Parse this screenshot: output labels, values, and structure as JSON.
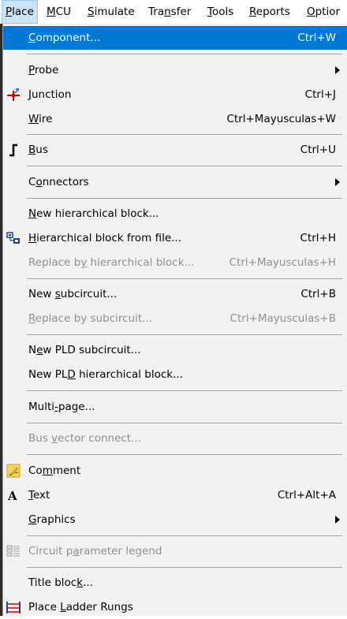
{
  "menubar": {
    "items": [
      {
        "pre": "",
        "acc": "P",
        "post": "lace"
      },
      {
        "pre": "",
        "acc": "M",
        "post": "CU"
      },
      {
        "pre": "",
        "acc": "S",
        "post": "imulate"
      },
      {
        "pre": "Tra",
        "acc": "n",
        "post": "sfer"
      },
      {
        "pre": "",
        "acc": "T",
        "post": "ools"
      },
      {
        "pre": "",
        "acc": "R",
        "post": "eports"
      },
      {
        "pre": "",
        "acc": "O",
        "post": "ptior"
      }
    ]
  },
  "menu": {
    "component": {
      "pre": "",
      "acc": "C",
      "post": "omponent...",
      "shortcut": "Ctrl+W"
    },
    "probe": {
      "pre": "",
      "acc": "P",
      "post": "robe"
    },
    "junction": {
      "pre": "",
      "acc": "J",
      "post": "unction",
      "shortcut": "Ctrl+J"
    },
    "wire": {
      "pre": "",
      "acc": "W",
      "post": "ire",
      "shortcut": "Ctrl+Mayusculas+W"
    },
    "bus": {
      "pre": "",
      "acc": "B",
      "post": "us",
      "shortcut": "Ctrl+U"
    },
    "connectors": {
      "pre": "C",
      "acc": "o",
      "post": "nnectors"
    },
    "new_hier_block": {
      "pre": "",
      "acc": "N",
      "post": "ew hierarchical block...",
      "shortcut": ""
    },
    "hier_block_file": {
      "pre": "",
      "acc": "H",
      "post": "ierarchical block from file...",
      "shortcut": "Ctrl+H"
    },
    "replace_hier": {
      "pre": "Replace b",
      "acc": "y",
      "post": " hierarchical block...",
      "shortcut": "Ctrl+Mayusculas+H"
    },
    "new_subcircuit": {
      "pre": "New ",
      "acc": "s",
      "post": "ubcircuit...",
      "shortcut": "Ctrl+B"
    },
    "replace_subcircuit": {
      "pre": "",
      "acc": "R",
      "post": "eplace by subcircuit...",
      "shortcut": "Ctrl+Mayusculas+B"
    },
    "new_pld_subcircuit": {
      "pre": "N",
      "acc": "e",
      "post": "w PLD subcircuit..."
    },
    "new_pld_hier": {
      "pre": "New PL",
      "acc": "D",
      "post": " hierarchical block..."
    },
    "multi_page": {
      "pre": "Multi",
      "acc": "-",
      "post": "page..."
    },
    "bus_vector": {
      "pre": "Bus ",
      "acc": "v",
      "post": "ector connect..."
    },
    "comment": {
      "pre": "Co",
      "acc": "m",
      "post": "ment"
    },
    "text": {
      "pre": "",
      "acc": "T",
      "post": "ext",
      "shortcut": "Ctrl+Alt+A"
    },
    "graphics": {
      "pre": "",
      "acc": "G",
      "post": "raphics"
    },
    "circuit_param": {
      "pre": "Circuit p",
      "acc": "a",
      "post": "rameter legend"
    },
    "title_block": {
      "pre": "Title bloc",
      "acc": "k",
      "post": "..."
    },
    "ladder": {
      "pre": "Place ",
      "acc": "L",
      "post": "adder Rungs"
    }
  },
  "icons": {
    "junction": "junction-icon",
    "bus": "bus-icon",
    "hier_file": "hierarchical-block-icon",
    "comment": "comment-icon",
    "text": "text-icon",
    "circuit_param": "parameter-legend-icon",
    "ladder": "ladder-rungs-icon"
  },
  "colors": {
    "highlight": "#0078d7",
    "menubar_active": "#cce4f7",
    "disabled": "#8f8f8f"
  }
}
